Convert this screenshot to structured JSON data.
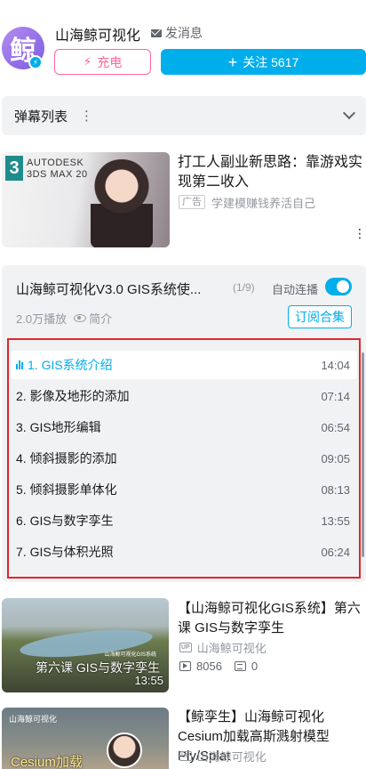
{
  "uploader": {
    "avatar_glyph": "鲸",
    "name": "山海鲸可视化",
    "message_label": "发消息",
    "charge_label": "充电",
    "follow_label": "关注 5617"
  },
  "danmaku": {
    "title": "弹幕列表",
    "menu_icon": "⋮"
  },
  "ad": {
    "thumb_logo": "3",
    "thumb_brand_line1": "AUTODESK",
    "thumb_brand_line2": "3DS MAX 20",
    "title": "打工人副业新思路：靠游戏实现第二收入",
    "tag": "广告",
    "source": "学建模赚钱养活自己",
    "more_icon": "⋮"
  },
  "collection": {
    "title": "山海鲸可视化V3.0 GIS系统使...",
    "count": "(1/9)",
    "autoplay_label": "自动连播",
    "autoplay_on": true,
    "views": "2.0万播放",
    "intro_label": "简介",
    "subscribe_label": "订阅合集",
    "episodes": [
      {
        "title": "1. GIS系统介绍",
        "duration": "14:04",
        "active": true
      },
      {
        "title": "2. 影像及地形的添加",
        "duration": "07:14",
        "active": false
      },
      {
        "title": "3. GIS地形编辑",
        "duration": "06:54",
        "active": false
      },
      {
        "title": "4. 倾斜摄影的添加",
        "duration": "09:05",
        "active": false
      },
      {
        "title": "5. 倾斜摄影单体化",
        "duration": "08:13",
        "active": false
      },
      {
        "title": "6. GIS与数字孪生",
        "duration": "13:55",
        "active": false
      },
      {
        "title": "7. GIS与体积光照",
        "duration": "06:24",
        "active": false
      }
    ]
  },
  "related": [
    {
      "thumb_sub": "山海鲸可视化GIS系统",
      "thumb_caption": "第六课 GIS与数字孪生",
      "duration": "13:55",
      "title": "【山海鲸可视化GIS系统】第六课 GIS与数字孪生",
      "up_badge": "UP",
      "uploader": "山海鲸可视化",
      "plays": "8056",
      "danmaku": "0"
    },
    {
      "thumb_brand": "山海鲸可视化",
      "thumb_caption": "Cesium加载",
      "title": "【鲸孪生】山海鲸可视化Cesium加载高斯溅射模型Ply/Splat",
      "up_badge": "UP",
      "uploader": "山海鲸可视化"
    }
  ]
}
